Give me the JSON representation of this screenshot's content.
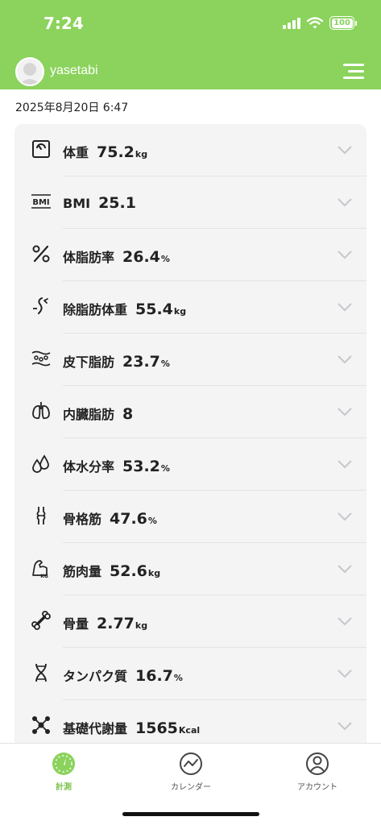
{
  "status": {
    "time": "7:24",
    "battery": "100"
  },
  "header": {
    "username": "yasetabi"
  },
  "measurement": {
    "datetime": "2025年8月20日 6:47"
  },
  "metrics": [
    {
      "icon": "scale-icon",
      "label": "体重",
      "value": "75.2",
      "unit": "kg"
    },
    {
      "icon": "bmi-icon",
      "label": "BMI",
      "value": "25.1",
      "unit": ""
    },
    {
      "icon": "percent-icon",
      "label": "体脂肪率",
      "value": "26.4",
      "unit": "%"
    },
    {
      "icon": "lean-body-icon",
      "label": "除脂肪体重",
      "value": "55.4",
      "unit": "kg"
    },
    {
      "icon": "subcutaneous-fat-icon",
      "label": "皮下脂肪",
      "value": "23.7",
      "unit": "%"
    },
    {
      "icon": "visceral-fat-icon",
      "label": "内臓脂肪",
      "value": "8",
      "unit": ""
    },
    {
      "icon": "water-drops-icon",
      "label": "体水分率",
      "value": "53.2",
      "unit": "%"
    },
    {
      "icon": "skeletal-muscle-icon",
      "label": "骨格筋",
      "value": "47.6",
      "unit": "%"
    },
    {
      "icon": "muscle-arm-icon",
      "label": "筋肉量",
      "value": "52.6",
      "unit": "kg"
    },
    {
      "icon": "bone-icon",
      "label": "骨量",
      "value": "2.77",
      "unit": "kg"
    },
    {
      "icon": "dna-icon",
      "label": "タンパク質",
      "value": "16.7",
      "unit": "%"
    },
    {
      "icon": "molecule-icon",
      "label": "基礎代謝量",
      "value": "1565",
      "unit": "Kcal"
    }
  ],
  "tabs": [
    {
      "icon": "gauge-icon",
      "label": "計測",
      "active": true
    },
    {
      "icon": "chart-line-icon",
      "label": "カレンダー",
      "active": false
    },
    {
      "icon": "account-icon",
      "label": "アカウント",
      "active": false
    }
  ],
  "colors": {
    "brand": "#8bd35c",
    "card": "#f4f4f5",
    "text": "#222222",
    "inactive": "#555555",
    "chevron": "#c7c7cc"
  }
}
